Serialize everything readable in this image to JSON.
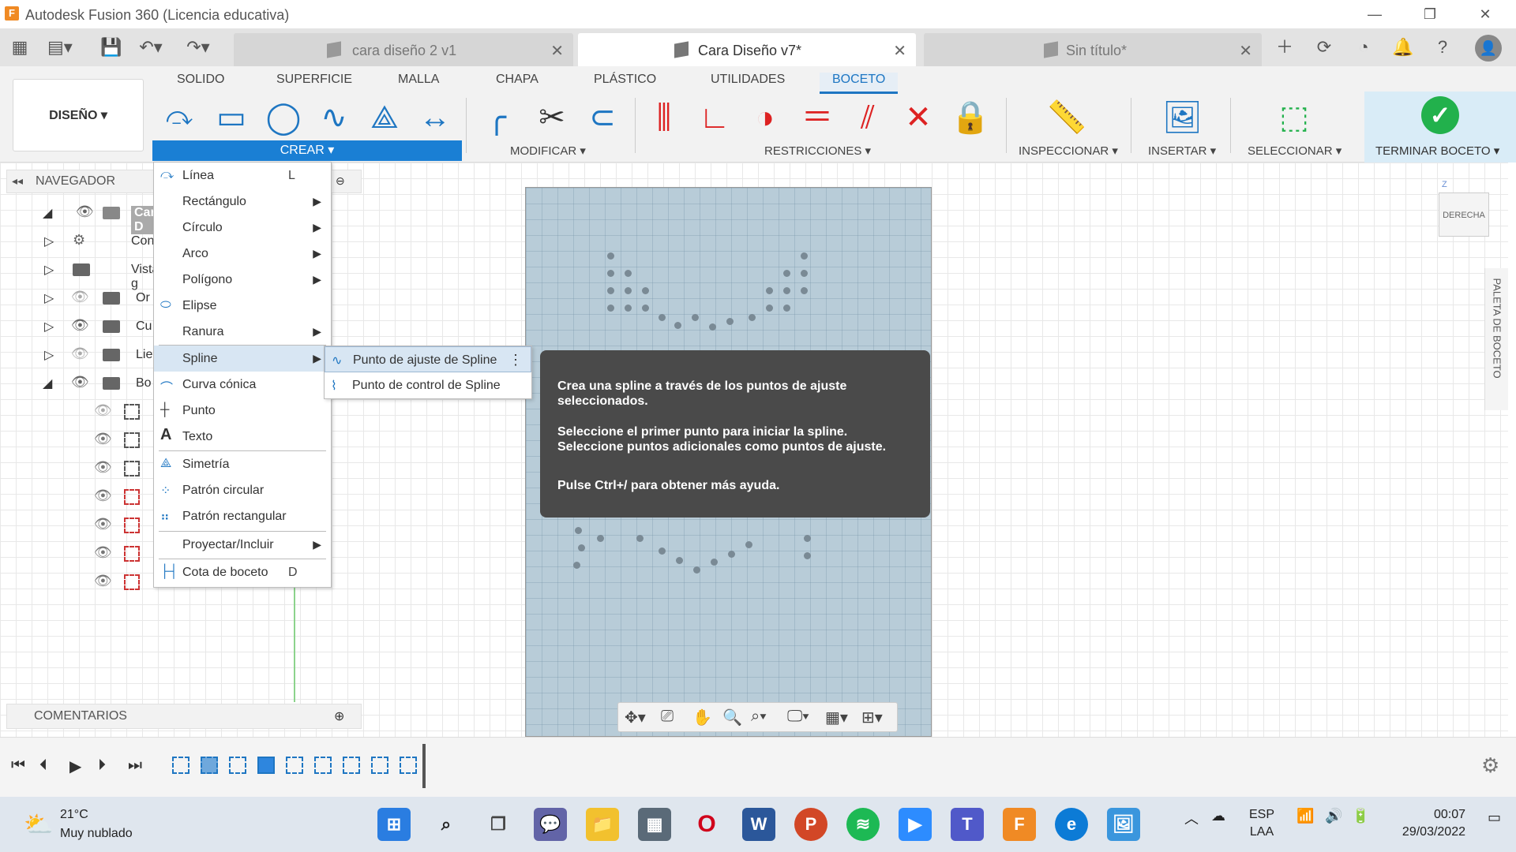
{
  "window": {
    "app_logo": "F",
    "title": "Autodesk Fusion 360 (Licencia educativa)",
    "controls": [
      "—",
      "❐",
      "✕"
    ]
  },
  "doc_tabs": [
    {
      "label": "cara diseño 2 v1",
      "active": false
    },
    {
      "label": "Cara Diseño v7*",
      "active": true
    },
    {
      "label": "Sin título*",
      "active": false
    }
  ],
  "ribbon_tabs": [
    "SOLIDO",
    "SUPERFICIE",
    "MALLA",
    "CHAPA",
    "PLÁSTICO",
    "UTILIDADES",
    "BOCETO"
  ],
  "workspace": {
    "label": "DISEÑO ▾"
  },
  "groups": {
    "crear": "CREAR ▾",
    "modificar": "MODIFICAR ▾",
    "restricciones": "RESTRICCIONES ▾",
    "inspeccionar": "INSPECCIONAR ▾",
    "insertar": "INSERTAR ▾",
    "seleccionar": "SELECCIONAR ▾",
    "terminar": "TERMINAR BOCETO ▾"
  },
  "navigator": {
    "title": "NAVEGADOR",
    "rows": [
      {
        "label": "Cara D"
      },
      {
        "label": "Configur"
      },
      {
        "label": "Vistas g"
      },
      {
        "label": "Or"
      },
      {
        "label": "Cu"
      },
      {
        "label": "Lie"
      },
      {
        "label": "Bo"
      }
    ]
  },
  "comments": {
    "label": "COMENTARIOS"
  },
  "create_menu": {
    "items": [
      {
        "label": "Línea",
        "shortcut": "L"
      },
      {
        "label": "Rectángulo",
        "submenu": true
      },
      {
        "label": "Círculo",
        "submenu": true
      },
      {
        "label": "Arco",
        "submenu": true
      },
      {
        "label": "Polígono",
        "submenu": true
      },
      {
        "label": "Elipse"
      },
      {
        "label": "Ranura",
        "submenu": true
      },
      {
        "label": "Spline",
        "submenu": true,
        "highlighted": true
      },
      {
        "label": "Curva cónica"
      },
      {
        "label": "Punto"
      },
      {
        "label": "Texto"
      },
      {
        "label": "Simetría"
      },
      {
        "label": "Patrón circular"
      },
      {
        "label": "Patrón rectangular"
      },
      {
        "label": "Proyectar/Incluir",
        "submenu": true
      },
      {
        "label": "Cota de boceto",
        "shortcut": "D"
      }
    ]
  },
  "spline_submenu": {
    "items": [
      {
        "label": "Punto de ajuste de Spline"
      },
      {
        "label": "Punto de control de Spline"
      }
    ]
  },
  "tooltip": {
    "p1": "Crea una spline a través de los puntos de ajuste seleccionados.",
    "p2": "Seleccione el primer punto para iniciar la spline. Seleccione puntos adicionales como puntos de ajuste.",
    "p3": "Pulse Ctrl+/ para obtener más ayuda."
  },
  "viewcube": {
    "label": "DERECHA"
  },
  "sketch_palette": {
    "label": "PALETA DE BOCETO"
  },
  "taskbar": {
    "temperature": "21°C",
    "condition": "Muy nublado",
    "lang1": "ESP",
    "lang2": "LAA",
    "time": "00:07",
    "date": "29/03/2022"
  }
}
